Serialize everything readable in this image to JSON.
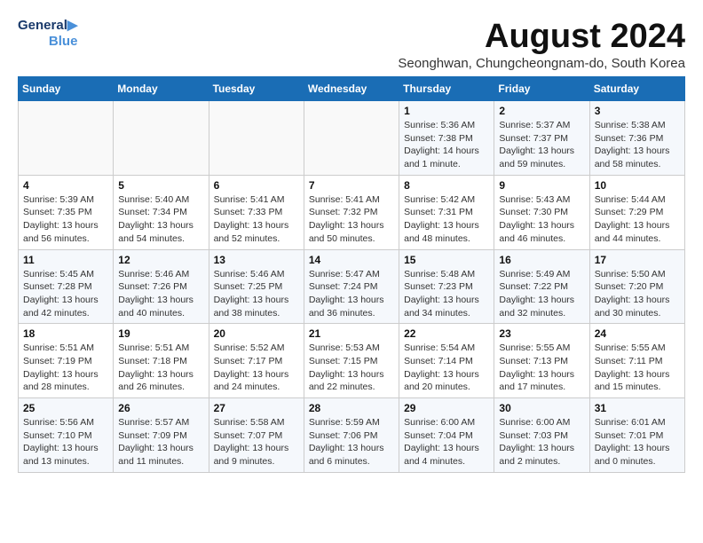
{
  "logo": {
    "line1": "General",
    "line2": "Blue"
  },
  "title": "August 2024",
  "subtitle": "Seonghwan, Chungcheongnam-do, South Korea",
  "days_of_week": [
    "Sunday",
    "Monday",
    "Tuesday",
    "Wednesday",
    "Thursday",
    "Friday",
    "Saturday"
  ],
  "weeks": [
    [
      {
        "day": "",
        "info": ""
      },
      {
        "day": "",
        "info": ""
      },
      {
        "day": "",
        "info": ""
      },
      {
        "day": "",
        "info": ""
      },
      {
        "day": "1",
        "info": "Sunrise: 5:36 AM\nSunset: 7:38 PM\nDaylight: 14 hours\nand 1 minute."
      },
      {
        "day": "2",
        "info": "Sunrise: 5:37 AM\nSunset: 7:37 PM\nDaylight: 13 hours\nand 59 minutes."
      },
      {
        "day": "3",
        "info": "Sunrise: 5:38 AM\nSunset: 7:36 PM\nDaylight: 13 hours\nand 58 minutes."
      }
    ],
    [
      {
        "day": "4",
        "info": "Sunrise: 5:39 AM\nSunset: 7:35 PM\nDaylight: 13 hours\nand 56 minutes."
      },
      {
        "day": "5",
        "info": "Sunrise: 5:40 AM\nSunset: 7:34 PM\nDaylight: 13 hours\nand 54 minutes."
      },
      {
        "day": "6",
        "info": "Sunrise: 5:41 AM\nSunset: 7:33 PM\nDaylight: 13 hours\nand 52 minutes."
      },
      {
        "day": "7",
        "info": "Sunrise: 5:41 AM\nSunset: 7:32 PM\nDaylight: 13 hours\nand 50 minutes."
      },
      {
        "day": "8",
        "info": "Sunrise: 5:42 AM\nSunset: 7:31 PM\nDaylight: 13 hours\nand 48 minutes."
      },
      {
        "day": "9",
        "info": "Sunrise: 5:43 AM\nSunset: 7:30 PM\nDaylight: 13 hours\nand 46 minutes."
      },
      {
        "day": "10",
        "info": "Sunrise: 5:44 AM\nSunset: 7:29 PM\nDaylight: 13 hours\nand 44 minutes."
      }
    ],
    [
      {
        "day": "11",
        "info": "Sunrise: 5:45 AM\nSunset: 7:28 PM\nDaylight: 13 hours\nand 42 minutes."
      },
      {
        "day": "12",
        "info": "Sunrise: 5:46 AM\nSunset: 7:26 PM\nDaylight: 13 hours\nand 40 minutes."
      },
      {
        "day": "13",
        "info": "Sunrise: 5:46 AM\nSunset: 7:25 PM\nDaylight: 13 hours\nand 38 minutes."
      },
      {
        "day": "14",
        "info": "Sunrise: 5:47 AM\nSunset: 7:24 PM\nDaylight: 13 hours\nand 36 minutes."
      },
      {
        "day": "15",
        "info": "Sunrise: 5:48 AM\nSunset: 7:23 PM\nDaylight: 13 hours\nand 34 minutes."
      },
      {
        "day": "16",
        "info": "Sunrise: 5:49 AM\nSunset: 7:22 PM\nDaylight: 13 hours\nand 32 minutes."
      },
      {
        "day": "17",
        "info": "Sunrise: 5:50 AM\nSunset: 7:20 PM\nDaylight: 13 hours\nand 30 minutes."
      }
    ],
    [
      {
        "day": "18",
        "info": "Sunrise: 5:51 AM\nSunset: 7:19 PM\nDaylight: 13 hours\nand 28 minutes."
      },
      {
        "day": "19",
        "info": "Sunrise: 5:51 AM\nSunset: 7:18 PM\nDaylight: 13 hours\nand 26 minutes."
      },
      {
        "day": "20",
        "info": "Sunrise: 5:52 AM\nSunset: 7:17 PM\nDaylight: 13 hours\nand 24 minutes."
      },
      {
        "day": "21",
        "info": "Sunrise: 5:53 AM\nSunset: 7:15 PM\nDaylight: 13 hours\nand 22 minutes."
      },
      {
        "day": "22",
        "info": "Sunrise: 5:54 AM\nSunset: 7:14 PM\nDaylight: 13 hours\nand 20 minutes."
      },
      {
        "day": "23",
        "info": "Sunrise: 5:55 AM\nSunset: 7:13 PM\nDaylight: 13 hours\nand 17 minutes."
      },
      {
        "day": "24",
        "info": "Sunrise: 5:55 AM\nSunset: 7:11 PM\nDaylight: 13 hours\nand 15 minutes."
      }
    ],
    [
      {
        "day": "25",
        "info": "Sunrise: 5:56 AM\nSunset: 7:10 PM\nDaylight: 13 hours\nand 13 minutes."
      },
      {
        "day": "26",
        "info": "Sunrise: 5:57 AM\nSunset: 7:09 PM\nDaylight: 13 hours\nand 11 minutes."
      },
      {
        "day": "27",
        "info": "Sunrise: 5:58 AM\nSunset: 7:07 PM\nDaylight: 13 hours\nand 9 minutes."
      },
      {
        "day": "28",
        "info": "Sunrise: 5:59 AM\nSunset: 7:06 PM\nDaylight: 13 hours\nand 6 minutes."
      },
      {
        "day": "29",
        "info": "Sunrise: 6:00 AM\nSunset: 7:04 PM\nDaylight: 13 hours\nand 4 minutes."
      },
      {
        "day": "30",
        "info": "Sunrise: 6:00 AM\nSunset: 7:03 PM\nDaylight: 13 hours\nand 2 minutes."
      },
      {
        "day": "31",
        "info": "Sunrise: 6:01 AM\nSunset: 7:01 PM\nDaylight: 13 hours\nand 0 minutes."
      }
    ]
  ]
}
